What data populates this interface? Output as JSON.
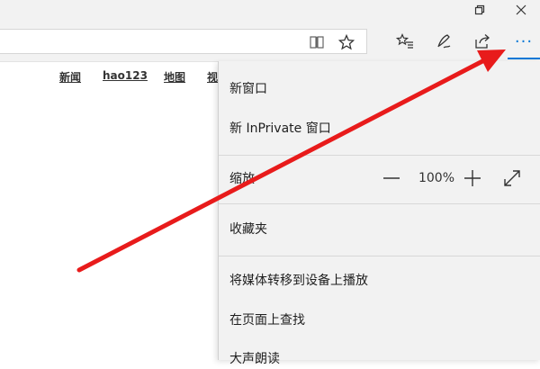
{
  "browser": {
    "window_controls": {
      "restore_icon": "restore-icon",
      "close_icon": "close-icon"
    },
    "address_bar": {
      "reading_view_icon": "reading-view-icon",
      "favorite_icon": "star-icon"
    },
    "toolbar_icons": [
      "favorites-hub-icon",
      "web-note-icon",
      "share-icon"
    ],
    "more_label": "···",
    "accent_color": "#0078d7"
  },
  "page": {
    "nav_links": [
      "新闻",
      "hao123",
      "地图",
      "视"
    ]
  },
  "menu": {
    "new_window": "新窗口",
    "new_inprivate": "新 InPrivate 窗口",
    "zoom_label": "缩放",
    "zoom_value": "100%",
    "zoom_out_icon": "minus-icon",
    "zoom_in_icon": "plus-icon",
    "fullscreen_icon": "fullscreen-icon",
    "favorites": "收藏夹",
    "cast_media": "将媒体转移到设备上播放",
    "find_on_page": "在页面上查找",
    "read_aloud": "大声朗读"
  },
  "annotation": {
    "arrow_color": "#e81b1b"
  }
}
